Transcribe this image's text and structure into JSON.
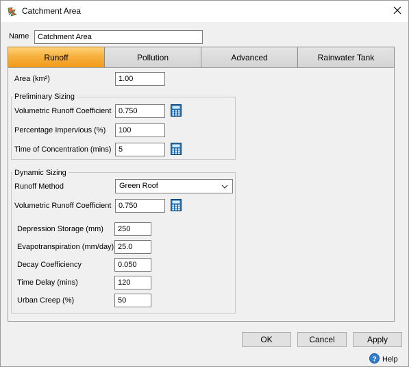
{
  "window": {
    "title": "Catchment Area",
    "icon": "catchment-app-icon",
    "close_icon": "close-icon"
  },
  "name_field": {
    "label": "Name",
    "value": "Catchment Area"
  },
  "tabs": [
    {
      "label": "Runoff",
      "active": true
    },
    {
      "label": "Pollution",
      "active": false
    },
    {
      "label": "Advanced",
      "active": false
    },
    {
      "label": "Rainwater Tank",
      "active": false
    }
  ],
  "area": {
    "label": "Area (km²)",
    "value": "1.00"
  },
  "preliminary": {
    "title": "Preliminary Sizing",
    "runoff_coeff": {
      "label": "Volumetric Runoff Coefficient",
      "value": "0.750"
    },
    "impervious": {
      "label": "Percentage Impervious (%)",
      "value": "100"
    },
    "concentration": {
      "label": "Time of Concentration (mins)",
      "value": "5"
    }
  },
  "dynamic": {
    "title": "Dynamic Sizing",
    "method": {
      "label": "Runoff Method",
      "value": "Green Roof"
    },
    "runoff_coeff": {
      "label": "Volumetric Runoff Coefficient",
      "value": "0.750"
    },
    "depression": {
      "label": "Depression Storage (mm)",
      "value": "250"
    },
    "evapo": {
      "label": "Evapotranspiration (mm/day)",
      "value": "25.0"
    },
    "decay": {
      "label": "Decay Coefficiency",
      "value": "0.050"
    },
    "delay": {
      "label": "Time Delay (mins)",
      "value": "120"
    },
    "creep": {
      "label": "Urban Creep (%)",
      "value": "50"
    }
  },
  "buttons": {
    "ok": "OK",
    "cancel": "Cancel",
    "apply": "Apply"
  },
  "help": {
    "label": "Help",
    "icon": "help-icon"
  },
  "colors": {
    "active_tab": "#f7b13e",
    "calculator_icon": "#1f6fb0"
  }
}
